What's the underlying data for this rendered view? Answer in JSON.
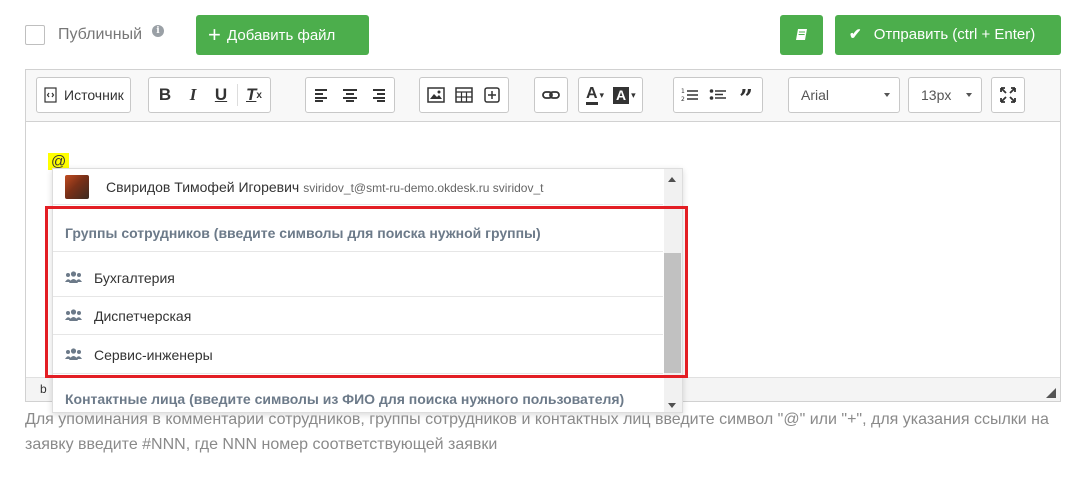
{
  "topbar": {
    "public_label": "Публичный",
    "info_icon": "info-icon",
    "add_file_label": "Добавить файл",
    "book_icon": "book-icon",
    "send_label": "Отправить (ctrl + Enter)",
    "accent_color": "#4cae4c"
  },
  "toolbar": {
    "source_label": "Источник",
    "font_value": "Arial",
    "size_value": "13px"
  },
  "editor": {
    "mention_char": "@",
    "status_text": "b"
  },
  "dropdown": {
    "user": {
      "name": "Свиридов Тимофей Игоревич",
      "meta": "sviridov_t@smt-ru-demo.okdesk.ru sviridov_t"
    },
    "groups_header": "Группы сотрудников (введите символы для поиска нужной группы)",
    "groups": [
      {
        "label": "Бухгалтерия"
      },
      {
        "label": "Диспетчерская"
      },
      {
        "label": "Сервис-инженеры"
      }
    ],
    "contacts_header": "Контактные лица (введите символы из ФИО для поиска нужного пользователя)"
  },
  "hint": "Для упоминания в комментарии сотрудников, группы сотрудников и контактных лиц введите символ \"@\" или \"+\", для указания ссылки на заявку введите #NNN, где NNN номер соответствующей заявки",
  "highlight_color": "#e31e24"
}
